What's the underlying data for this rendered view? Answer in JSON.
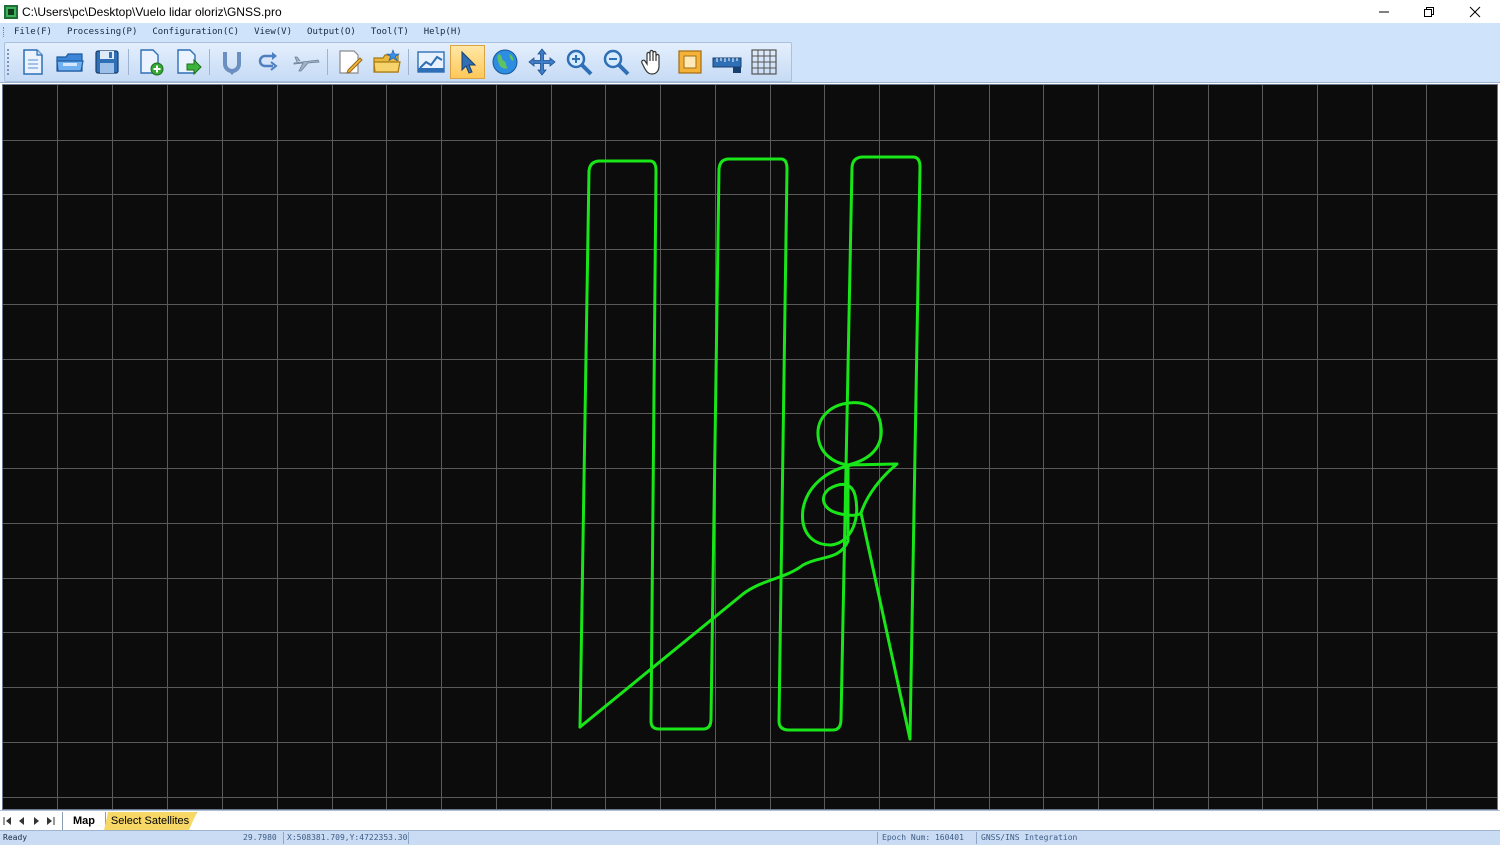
{
  "window": {
    "title": "C:\\Users\\pc\\Desktop\\Vuelo lidar oloriz\\GNSS.pro",
    "controls": [
      "minimize-icon",
      "restore-icon",
      "close-icon"
    ]
  },
  "menu": [
    {
      "label": "File(F)"
    },
    {
      "label": "Processing(P)"
    },
    {
      "label": "Configuration(C)"
    },
    {
      "label": "View(V)"
    },
    {
      "label": "Output(O)"
    },
    {
      "label": "Tool(T)"
    },
    {
      "label": "Help(H)"
    }
  ],
  "toolbar": {
    "buttons": [
      "new-document-icon",
      "open-folder-icon",
      "save-icon",
      "add-file-icon",
      "export-icon",
      "magnet-icon",
      "redo-icon",
      "aircraft-icon",
      "edit-document-icon",
      "folder-star-icon",
      "chart-icon",
      "select-arrow-icon",
      "globe-icon",
      "pan-arrows-icon",
      "zoom-in-icon",
      "zoom-out-icon",
      "hand-icon",
      "zoom-extent-icon",
      "ruler-icon",
      "grid-icon"
    ],
    "active": "select-arrow-icon"
  },
  "colors": {
    "map_background": "#0c0c0c",
    "grid_line": "#5a5a5a",
    "trajectory": "#19e619",
    "active_tab": "#ffffff",
    "inactive_tab": "#f7d867"
  },
  "tabs": [
    {
      "label": "Map",
      "active": true
    },
    {
      "label": "Select Satellites",
      "active": false
    }
  ],
  "status": {
    "state": "Ready",
    "value": "29.7980",
    "coords": "X:508381.709,Y:4722353.30",
    "epoch": "Epoch Num: 160401",
    "mode": "GNSS/INS Integration"
  }
}
